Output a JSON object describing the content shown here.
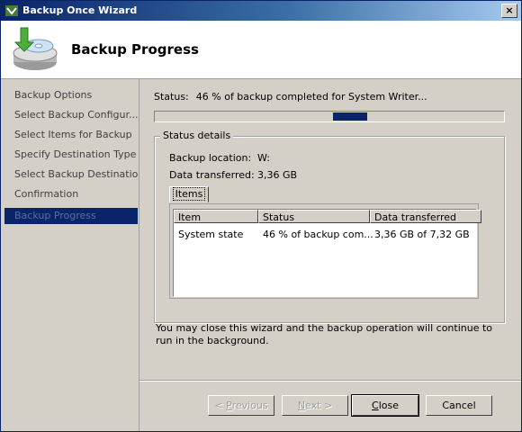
{
  "window": {
    "title": "Backup Once Wizard",
    "close_glyph": "×"
  },
  "header": {
    "title": "Backup Progress",
    "icon": "backup-drive-icon"
  },
  "sidebar": {
    "items": [
      {
        "label": "Backup Options",
        "active": false
      },
      {
        "label": "Select Backup Configur...",
        "active": false
      },
      {
        "label": "Select Items for Backup",
        "active": false
      },
      {
        "label": "Specify Destination Type",
        "active": false
      },
      {
        "label": "Select Backup Destination",
        "active": false
      },
      {
        "label": "Confirmation",
        "active": false
      },
      {
        "label": "Backup Progress",
        "active": true
      }
    ]
  },
  "status": {
    "label": "Status:",
    "value": "46 % of backup completed for System Writer..."
  },
  "details": {
    "legend": "Status details",
    "location_label": "Backup location:",
    "location_value": "W:",
    "transferred_label": "Data transferred:",
    "transferred_value": "3,36 GB",
    "tab_label": "Items",
    "columns": [
      "Item",
      "Status",
      "Data transferred"
    ],
    "rows": [
      {
        "item": "System state",
        "status": "46 % of backup com...",
        "transferred": "3,36 GB of 7,32 GB"
      }
    ]
  },
  "note": "You may close this wizard and the backup operation will continue to run in the background.",
  "buttons": {
    "previous_pre": "< ",
    "previous_u": "P",
    "previous_post": "revious",
    "next_pre": "",
    "next_u": "N",
    "next_post": "ext >",
    "close_pre": "",
    "close_u": "C",
    "close_post": "lose",
    "cancel": "Cancel"
  },
  "colors": {
    "accent": "#0a246a",
    "face": "#d4d0c8"
  }
}
